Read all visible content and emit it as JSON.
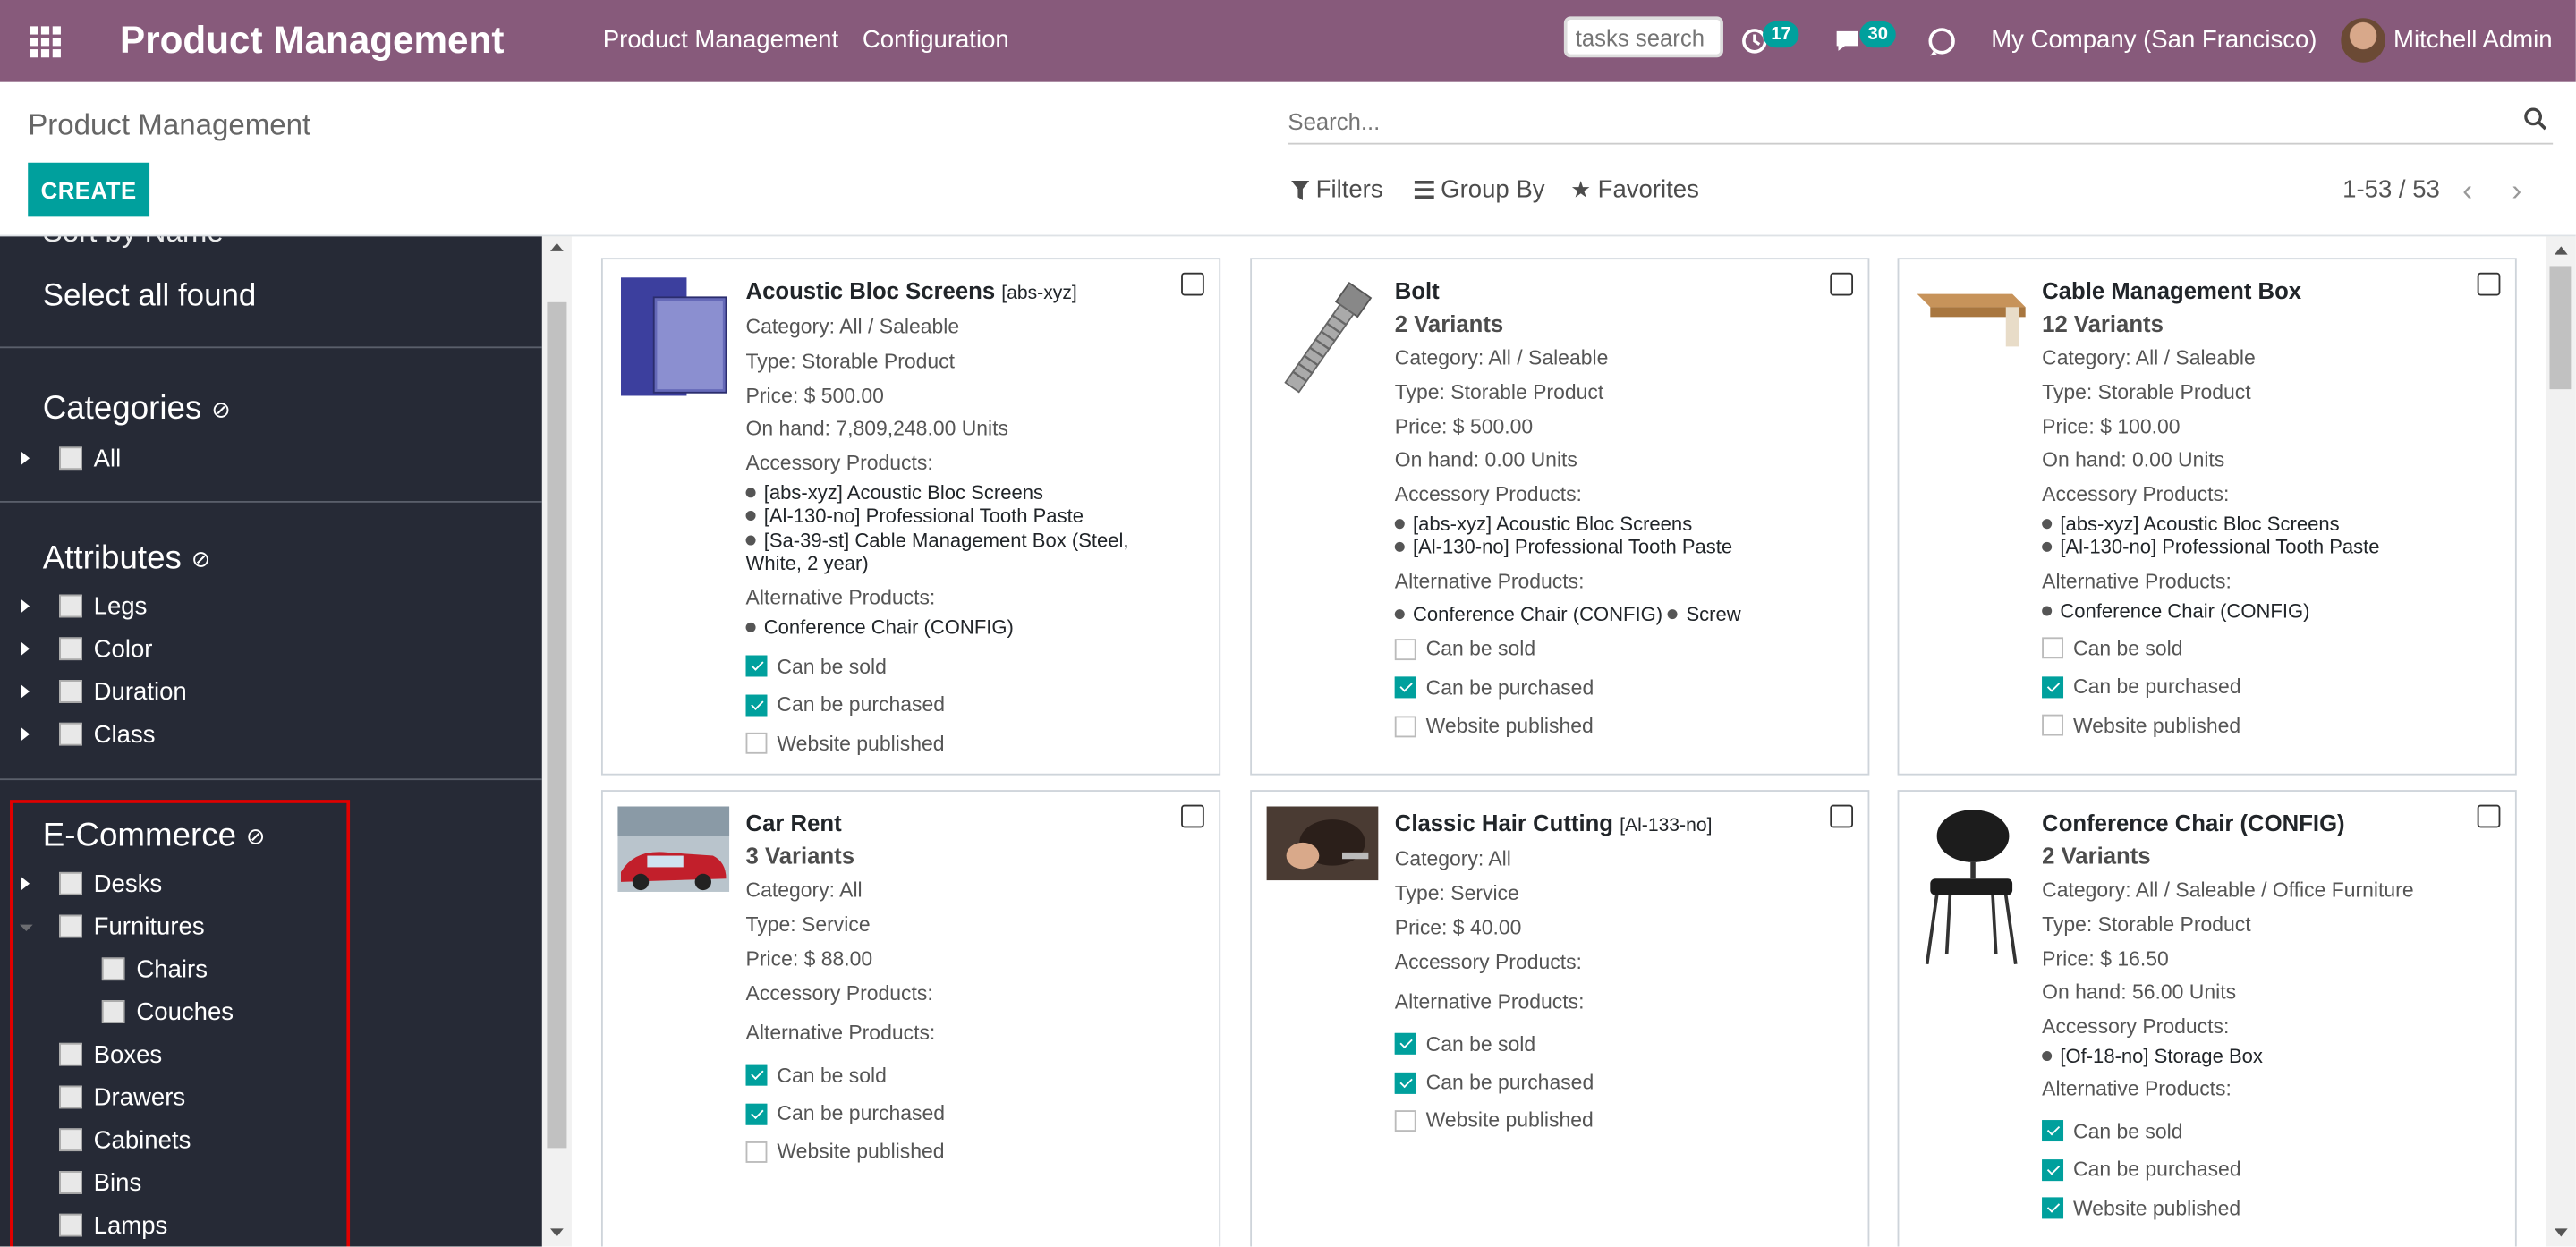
{
  "topbar": {
    "app_title": "Product Management",
    "menu": [
      "Product Management",
      "Configuration"
    ],
    "tasks_search_placeholder": "tasks search",
    "activity_count": "17",
    "messages_count": "30",
    "company": "My Company (San Francisco)",
    "user": "Mitchell Admin",
    "color": "#875a7b"
  },
  "control_panel": {
    "breadcrumb": "Product Management",
    "create_label": "CREATE",
    "search_placeholder": "Search...",
    "filters_label": "Filters",
    "groupby_label": "Group By",
    "favorites_label": "Favorites",
    "pager": "1-53 / 53",
    "accent": "#00a09d"
  },
  "sidebar": {
    "sort_by": "Sort by   Name",
    "select_all": "Select all found",
    "categories": {
      "title": "Categories",
      "items": [
        "All"
      ]
    },
    "attributes": {
      "title": "Attributes",
      "items": [
        "Legs",
        "Color",
        "Duration",
        "Class"
      ]
    },
    "ecommerce": {
      "title": "E-Commerce",
      "items": [
        "Desks",
        "Furnitures",
        "Chairs",
        "Couches",
        "Boxes",
        "Drawers",
        "Cabinets",
        "Bins",
        "Lamps"
      ]
    }
  },
  "labels": {
    "accessory": "Accessory Products:",
    "alternative": "Alternative Products:",
    "can_be_sold": "Can be sold",
    "can_be_purchased": "Can be purchased",
    "website_published": "Website published"
  },
  "products": [
    {
      "name": "Acoustic Bloc Screens",
      "ref": "[abs-xyz]",
      "variants": "",
      "category": "Category: All / Saleable",
      "type": "Type: Storable Product",
      "price": "Price: $ 500.00",
      "on_hand": "On hand: 7,809,248.00 Units",
      "accessories": [
        "[abs-xyz] Acoustic Bloc Screens",
        "[Al-130-no] Professional Tooth Paste",
        "[Sa-39-st] Cable Management Box (Steel, White, 2 year)"
      ],
      "alternatives": [
        "Conference Chair (CONFIG)"
      ],
      "sold": true,
      "purchased": true,
      "published": false
    },
    {
      "name": "Bolt",
      "ref": "",
      "variants": "2 Variants",
      "category": "Category: All / Saleable",
      "type": "Type: Storable Product",
      "price": "Price: $ 500.00",
      "on_hand": "On hand: 0.00 Units",
      "accessories": [
        "[abs-xyz] Acoustic Bloc Screens",
        "[Al-130-no] Professional Tooth Paste"
      ],
      "alternatives": [
        "Conference Chair (CONFIG)",
        "Screw"
      ],
      "sold": false,
      "purchased": true,
      "published": false
    },
    {
      "name": "Cable Management Box",
      "ref": "",
      "variants": "12 Variants",
      "category": "Category: All / Saleable",
      "type": "Type: Storable Product",
      "price": "Price: $ 100.00",
      "on_hand": "On hand: 0.00 Units",
      "accessories": [
        "[abs-xyz] Acoustic Bloc Screens",
        "[Al-130-no] Professional Tooth Paste"
      ],
      "alternatives": [
        "Conference Chair (CONFIG)"
      ],
      "sold": false,
      "purchased": true,
      "published": false
    },
    {
      "name": "Car Rent",
      "ref": "",
      "variants": "3 Variants",
      "category": "Category: All",
      "type": "Type: Service",
      "price": "Price: $ 88.00",
      "on_hand": "",
      "accessories": [],
      "alternatives": [],
      "sold": true,
      "purchased": true,
      "published": false
    },
    {
      "name": "Classic Hair Cutting",
      "ref": "[Al-133-no]",
      "variants": "",
      "category": "Category: All",
      "type": "Type: Service",
      "price": "Price: $ 40.00",
      "on_hand": "",
      "accessories": [],
      "alternatives": [],
      "sold": true,
      "purchased": true,
      "published": false
    },
    {
      "name": "Conference Chair (CONFIG)",
      "ref": "",
      "variants": "2 Variants",
      "category": "Category: All / Saleable / Office Furniture",
      "type": "Type: Storable Product",
      "price": "Price: $ 16.50",
      "on_hand": "On hand: 56.00 Units",
      "accessories": [
        "[Of-18-no] Storage Box"
      ],
      "alternatives": [],
      "sold": true,
      "purchased": true,
      "published": true
    }
  ]
}
